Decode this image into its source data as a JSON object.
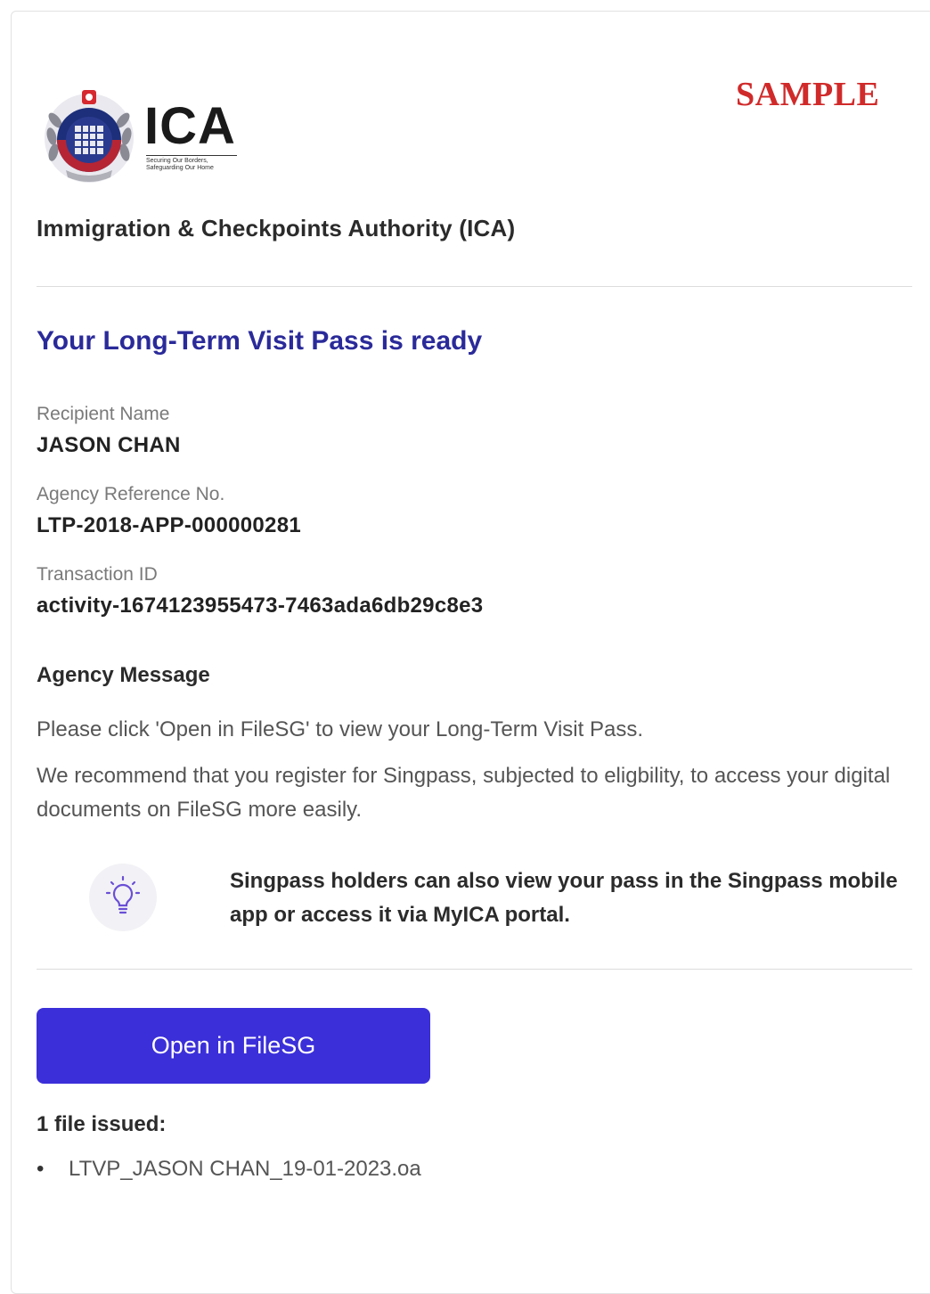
{
  "header": {
    "logo_wordmark": "ICA",
    "logo_tagline_line1": "Securing Our Borders,",
    "logo_tagline_line2": "Safeguarding Our Home",
    "sample_watermark": "SAMPLE",
    "agency_name": "Immigration & Checkpoints Authority (ICA)"
  },
  "notice": {
    "title": "Your Long-Term Visit Pass is ready",
    "fields": [
      {
        "label": "Recipient Name",
        "value": "JASON CHAN"
      },
      {
        "label": "Agency Reference No.",
        "value": "LTP-2018-APP-000000281"
      },
      {
        "label": "Transaction ID",
        "value": "activity-1674123955473-7463ada6db29c8e3"
      }
    ]
  },
  "agency_message": {
    "heading": "Agency Message",
    "paragraph1": "Please click 'Open in FileSG' to view your Long-Term Visit Pass.",
    "paragraph2": "We recommend that you register for Singpass, subjected to eligbility, to access your digital documents on FileSG more easily."
  },
  "tip": {
    "icon": "lightbulb-icon",
    "text": "Singpass holders can also view your pass in the Singpass mobile app or access it via MyICA portal."
  },
  "action": {
    "button_label": "Open in FileSG"
  },
  "files": {
    "heading": "1 file issued:",
    "items": [
      "LTVP_JASON CHAN_19-01-2023.oa"
    ]
  },
  "colors": {
    "title": "#2a2a9a",
    "button": "#3b2fd9",
    "sample": "#d02a2a"
  }
}
